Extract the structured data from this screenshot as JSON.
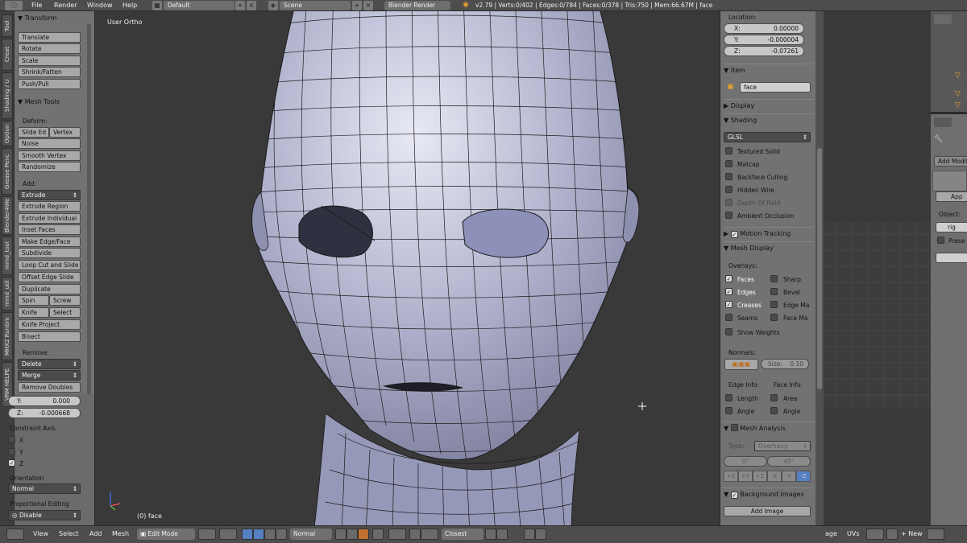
{
  "topbar": {
    "menus": [
      "File",
      "Render",
      "Window",
      "Help"
    ],
    "layout": "Default",
    "scene": "Scene",
    "engine": "Blender Render",
    "stats": "v2.79 | Verts:0/402 | Edges:0/784 | Faces:0/378 | Tris:750 | Mem:66.67M | face"
  },
  "tabs": [
    "Tool",
    "Creat",
    "Shading / U",
    "Option",
    "Grease Penc",
    "Blender4We",
    "mmd_tool",
    "mmd_util",
    "MHX2 Runtim",
    "VRM HELPE"
  ],
  "toolshelf": {
    "transform_header": "Transform",
    "transform_buttons": [
      "Translate",
      "Rotate",
      "Scale",
      "Shrink/Fatten",
      "Push/Pull"
    ],
    "meshtools_header": "Mesh Tools",
    "deform_label": "Deform:",
    "slide_edge": "Slide Ed",
    "vertex": "Vertex",
    "noise": "Noise",
    "smooth_vertex": "Smooth Vertex",
    "randomize": "Randomize",
    "add_label": "Add:",
    "extrude": "Extrude",
    "add_buttons": [
      "Extrude Region",
      "Extrude Individual",
      "Inset Faces",
      "Make Edge/Face",
      "Subdivide",
      "Loop Cut and Slide",
      "Offset Edge Slide",
      "Duplicate"
    ],
    "spin": "Spin",
    "screw": "Screw",
    "knife": "Knife",
    "select": "Select",
    "knife_project": "Knife Project",
    "bisect": "Bisect",
    "remove_label": "Remove:",
    "delete": "Delete",
    "merge": "Merge",
    "remove_doubles": "Remove Doubles"
  },
  "operator": {
    "y_label": "Y:",
    "y_value": "0.000",
    "z_label": "Z:",
    "z_value": "-0.000668",
    "constraint_label": "Constraint Axis",
    "axes": [
      {
        "label": "X",
        "checked": false
      },
      {
        "label": "Y",
        "checked": false
      },
      {
        "label": "Z",
        "checked": true
      }
    ],
    "orientation_label": "Orientation",
    "orientation_value": "Normal",
    "prop_edit_label": "Proportional Editing",
    "prop_edit_value": "Disable"
  },
  "viewport": {
    "view_name": "User Ortho",
    "object_label": "(0) face"
  },
  "properties": {
    "location_label": "Location:",
    "x_label": "X:",
    "x_value": "0.00000",
    "y_label": "Y:",
    "y_value": "-0.000004",
    "z_label": "Z:",
    "z_value": "-0.07261",
    "item_header": "Item",
    "item_name": "face",
    "display_header": "Display",
    "shading_header": "Shading",
    "shading_mode": "GLSL",
    "shading_options": [
      {
        "label": "Textured Solid",
        "checked": false
      },
      {
        "label": "Matcap",
        "checked": false
      },
      {
        "label": "Backface Culling",
        "checked": false
      },
      {
        "label": "Hidden Wire",
        "checked": false
      },
      {
        "label": "Depth Of Field",
        "checked": false
      },
      {
        "label": "Ambient Occlusion",
        "checked": false
      }
    ],
    "motion_tracking": "Motion Tracking",
    "mesh_display_header": "Mesh Display",
    "overlays_label": "Overlays:",
    "overlays_left": [
      {
        "label": "Faces",
        "checked": true
      },
      {
        "label": "Edges",
        "checked": true
      },
      {
        "label": "Creases",
        "checked": true
      },
      {
        "label": "Seams",
        "checked": false
      }
    ],
    "overlays_right": [
      {
        "label": "Sharp",
        "checked": false
      },
      {
        "label": "Bevel",
        "checked": false
      },
      {
        "label": "Edge Ma",
        "checked": false
      },
      {
        "label": "Face Ma",
        "checked": false
      }
    ],
    "show_weights": "Show Weights",
    "normals_label": "Normals:",
    "size_label": "Size:",
    "size_value": "0.10",
    "edge_info_label": "Edge Info:",
    "face_info_label": "Face Info:",
    "length": "Length",
    "area": "Area",
    "angle_edge": "Angle",
    "angle_face": "Angle",
    "mesh_analysis": "Mesh Analysis",
    "type_label": "Type:",
    "type_value": "Overhang",
    "angle_min": "0°",
    "angle_max": "45°",
    "axis_buttons": [
      "+X",
      "+Y",
      "+Z",
      "-X",
      "-Y",
      "-Z"
    ],
    "background_images": "Background Images",
    "add_image": "Add Image"
  },
  "right_properties": {
    "add_modifier": "Add Modifi",
    "apply": "App",
    "object_label": "Object:",
    "object_value": "rig",
    "preserve": "Prese"
  },
  "bottombar": {
    "menus": [
      "View",
      "Select",
      "Add",
      "Mesh"
    ],
    "mode": "Edit Mode",
    "pivot": "Normal",
    "snap": "Closest",
    "right_items": [
      "age",
      "UVs"
    ],
    "new": "New"
  },
  "colors": {
    "accent_blue": "#5680c2",
    "mesh_face": "#a9abc9",
    "mesh_edge": "#1a1a1a"
  }
}
